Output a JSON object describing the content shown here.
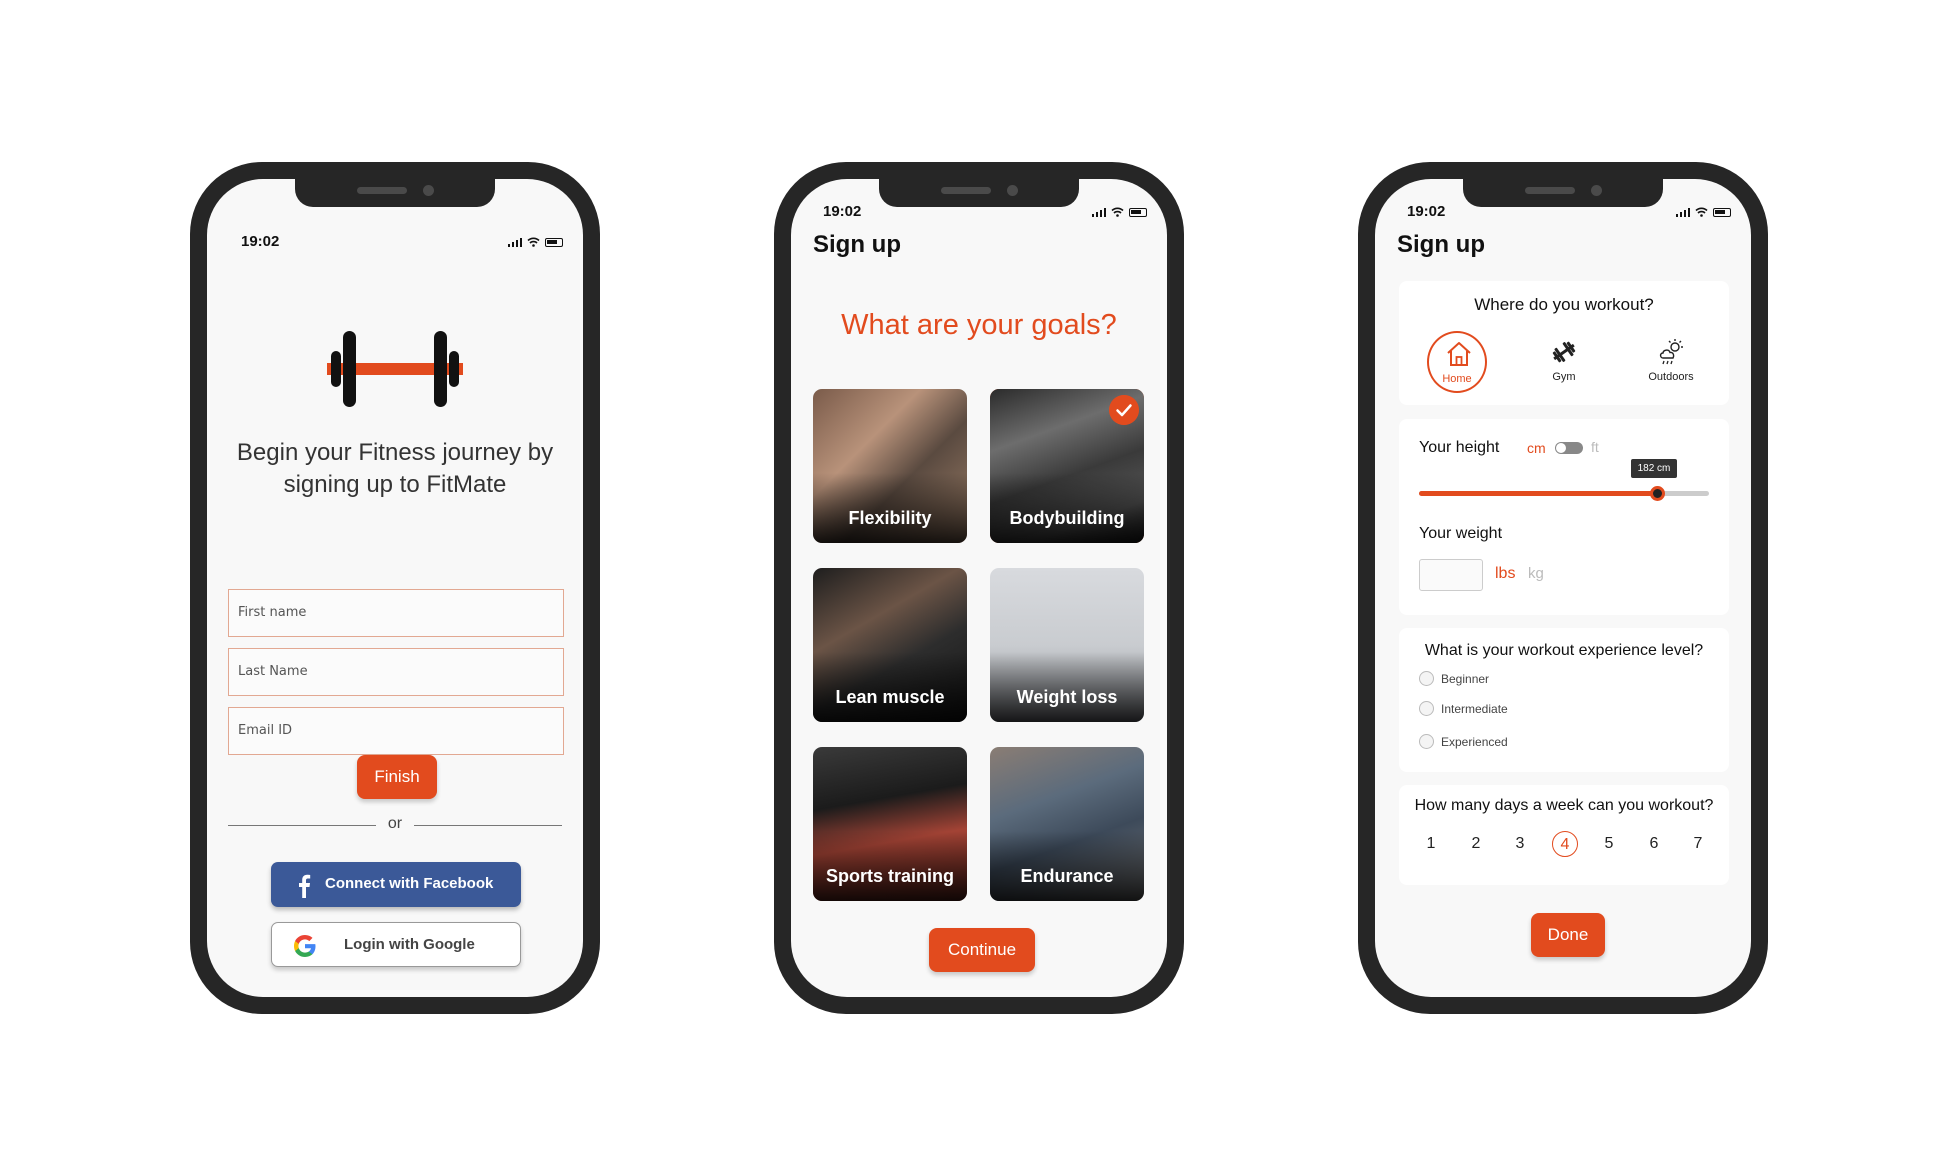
{
  "accent_color": "#e24b1e",
  "phones": [
    {
      "status_time": "19:02",
      "title": "Begin your Fitness journey by signing up to FitMate",
      "fields": [
        {
          "placeholder": "First name"
        },
        {
          "placeholder": "Last Name"
        },
        {
          "placeholder": "Email ID"
        }
      ],
      "finish_label": "Finish",
      "or_label": "or",
      "facebook_label": "Connect with Facebook",
      "google_label": "Login with Google",
      "logo_icon": "dumbbell-icon"
    },
    {
      "status_time": "19:02",
      "header": "Sign up",
      "question": "What are your goals?",
      "goals": [
        {
          "label": "Flexibility",
          "selected": false
        },
        {
          "label": "Bodybuilding",
          "selected": true
        },
        {
          "label": "Lean muscle",
          "selected": false
        },
        {
          "label": "Weight loss",
          "selected": false
        },
        {
          "label": "Sports training",
          "selected": false
        },
        {
          "label": "Endurance",
          "selected": false
        }
      ],
      "continue_label": "Continue"
    },
    {
      "status_time": "19:02",
      "header": "Sign up",
      "where_question": "Where do you workout?",
      "locations": [
        {
          "label": "Home",
          "icon": "home-icon",
          "active": true
        },
        {
          "label": "Gym",
          "icon": "dumbbell-icon",
          "active": false
        },
        {
          "label": "Outdoors",
          "icon": "weather-icon",
          "active": false
        }
      ],
      "height_label": "Your height",
      "height_unit_on": "cm",
      "height_unit_off": "ft",
      "height_value_label": "182 cm",
      "height_slider_fraction": 0.82,
      "weight_label": "Your weight",
      "weight_unit_on": "lbs",
      "weight_unit_off": "kg",
      "experience_question": "What is your workout experience level?",
      "experience_options": [
        "Beginner",
        "Intermediate",
        "Experienced"
      ],
      "days_question": "How many days a week can you workout?",
      "days": [
        "1",
        "2",
        "3",
        "4",
        "5",
        "6",
        "7"
      ],
      "days_selected": "4",
      "done_label": "Done"
    }
  ]
}
